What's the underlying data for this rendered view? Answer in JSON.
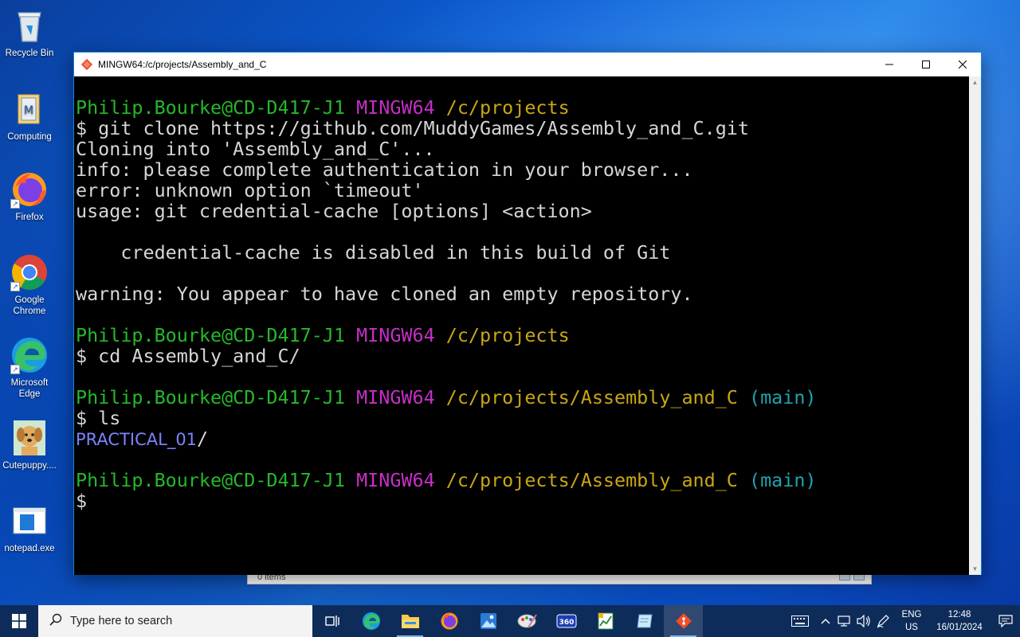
{
  "desktop": {
    "icons": [
      {
        "label": "Recycle Bin"
      },
      {
        "label": "Computing"
      },
      {
        "label": "Firefox"
      },
      {
        "label": "Google Chrome"
      },
      {
        "label": "Microsoft Edge"
      },
      {
        "label": "Cutepuppy...."
      },
      {
        "label": "notepad.exe"
      }
    ]
  },
  "background_window": {
    "status_text": "0 items"
  },
  "terminal": {
    "title": "MINGW64:/c/projects/Assembly_and_C",
    "lines": [
      {
        "user": "Philip.Bourke@CD-D417-J1",
        "system": "MINGW64",
        "path": "/c/projects",
        "branch": ""
      },
      {
        "text": "$ git clone https://github.com/MuddyGames/Assembly_and_C.git"
      },
      {
        "text": "Cloning into 'Assembly_and_C'..."
      },
      {
        "text": "info: please complete authentication in your browser..."
      },
      {
        "text": "error: unknown option `timeout'"
      },
      {
        "text": "usage: git credential-cache [options] <action>"
      },
      {
        "text": ""
      },
      {
        "text": "    credential-cache is disabled in this build of Git"
      },
      {
        "text": ""
      },
      {
        "text": "warning: You appear to have cloned an empty repository."
      },
      {
        "text": ""
      },
      {
        "user": "Philip.Bourke@CD-D417-J1",
        "system": "MINGW64",
        "path": "/c/projects",
        "branch": ""
      },
      {
        "text": "$ cd Assembly_and_C/"
      },
      {
        "text": ""
      },
      {
        "user": "Philip.Bourke@CD-D417-J1",
        "system": "MINGW64",
        "path": "/c/projects/Assembly_and_C",
        "branch": "(main)"
      },
      {
        "text": "$ ls"
      },
      {
        "dir": "PRACTICAL_01",
        "suffix": "/"
      },
      {
        "text": ""
      },
      {
        "user": "Philip.Bourke@CD-D417-J1",
        "system": "MINGW64",
        "path": "/c/projects/Assembly_and_C",
        "branch": "(main)"
      },
      {
        "text": "$"
      }
    ]
  },
  "taskbar": {
    "search_placeholder": "Type here to search",
    "apps": [
      "task-view-icon",
      "edge-icon",
      "file-explorer-icon",
      "firefox-icon",
      "photos-icon",
      "paint-icon",
      "360-icon",
      "chart-app-icon",
      "notepad-icon",
      "git-bash-icon"
    ],
    "language_line1": "ENG",
    "language_line2": "US",
    "time": "12:48",
    "date": "16/01/2024"
  },
  "colors": {
    "prompt_user": "#26b82b",
    "prompt_system": "#c52fc6",
    "prompt_path": "#c9a615",
    "prompt_branch": "#1fa3ad",
    "directory": "#7b84ff"
  }
}
